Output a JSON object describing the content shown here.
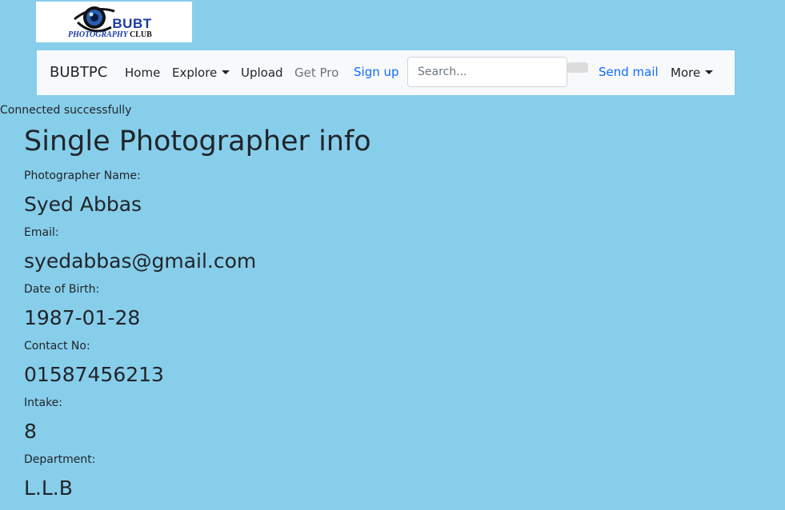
{
  "logo": {
    "title": "BUBT",
    "subtitle": "PHOTOGRAPHY",
    "subtitle_suffix": "CLUB"
  },
  "navbar": {
    "brand": "BUBTPC",
    "items": [
      {
        "label": "Home"
      },
      {
        "label": "Explore"
      },
      {
        "label": "Upload"
      },
      {
        "label": "Get Pro"
      },
      {
        "label": "Sign up"
      },
      {
        "label": "Send mail"
      },
      {
        "label": "More"
      }
    ],
    "search": {
      "placeholder": "Search...",
      "value": ""
    }
  },
  "status_message": "Connected successfully",
  "page": {
    "title": "Single Photographer info",
    "fields": [
      {
        "label": "Photographer Name:",
        "value": "Syed Abbas"
      },
      {
        "label": "Email:",
        "value": "syedabbas@gmail.com"
      },
      {
        "label": "Date of Birth:",
        "value": "1987-01-28"
      },
      {
        "label": "Contact No:",
        "value": "01587456213"
      },
      {
        "label": "Intake:",
        "value": "8"
      },
      {
        "label": "Department:",
        "value": "L.L.B"
      }
    ]
  },
  "colors": {
    "page_background": "#87ceeb",
    "navbar_background": "#f8f9fa",
    "link": "#0d6efd",
    "muted": "#6c757d",
    "logo_blue": "#1a3aa8"
  }
}
